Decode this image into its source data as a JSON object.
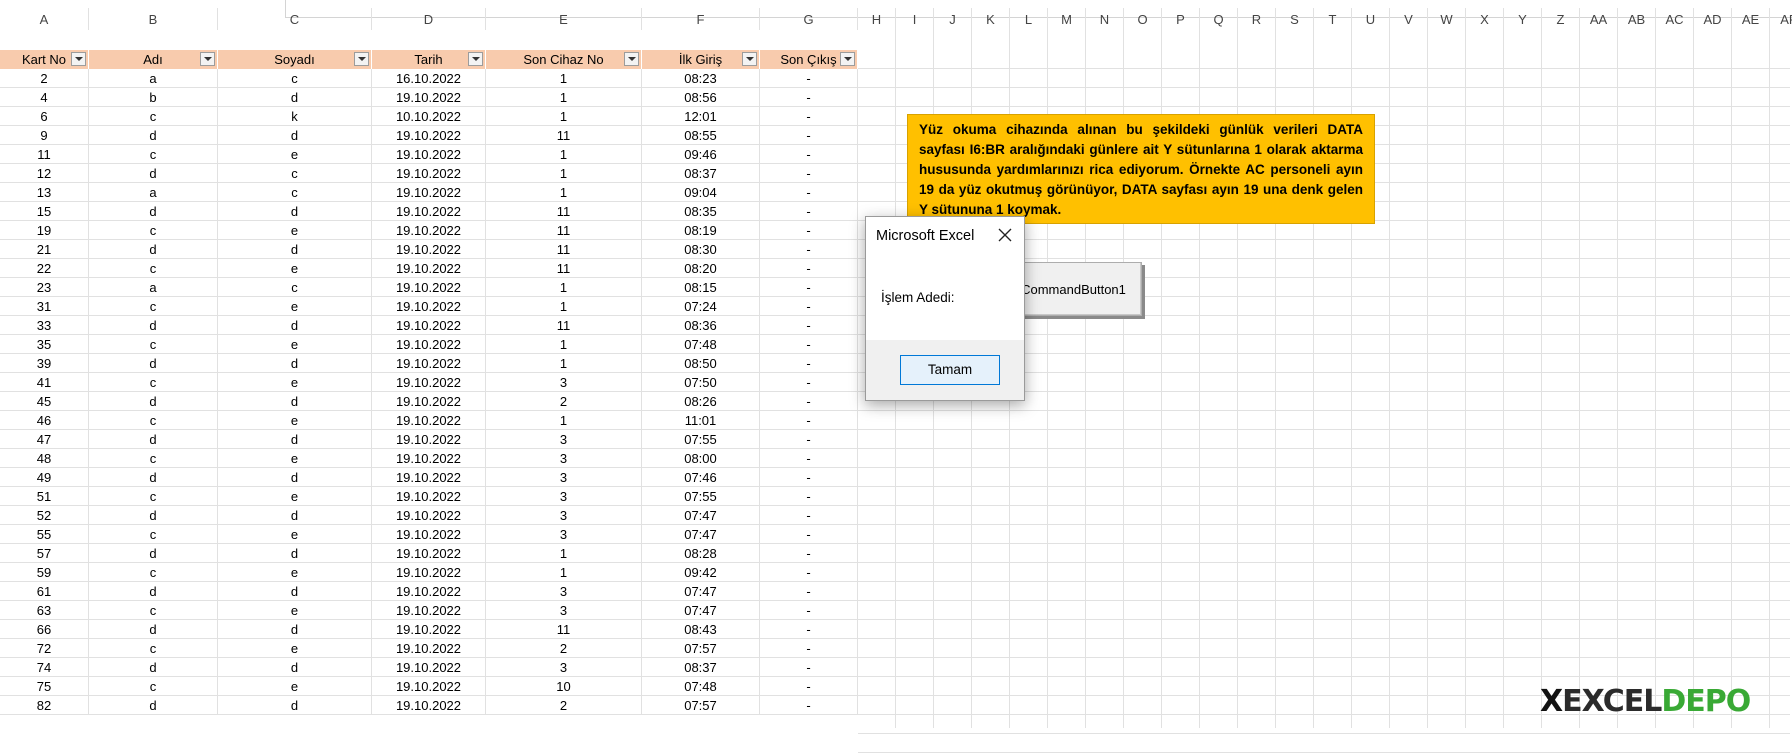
{
  "columns": [
    "A",
    "B",
    "C",
    "D",
    "E",
    "F",
    "G",
    "H",
    "I",
    "J",
    "K",
    "L",
    "M",
    "N",
    "O",
    "P",
    "Q",
    "R",
    "S",
    "T",
    "U",
    "V",
    "W",
    "X",
    "Y",
    "Z",
    "AA",
    "AB",
    "AC",
    "AD",
    "AE",
    "AF"
  ],
  "headers": [
    "Kart No",
    "Adı",
    "Soyadı",
    "Tarih",
    "Son Cihaz No",
    "İlk Giriş",
    "Son Çıkış"
  ],
  "rows": [
    [
      "2",
      "a",
      "c",
      "16.10.2022",
      "1",
      "08:23",
      "-"
    ],
    [
      "4",
      "b",
      "d",
      "19.10.2022",
      "1",
      "08:56",
      "-"
    ],
    [
      "6",
      "c",
      "k",
      "10.10.2022",
      "1",
      "12:01",
      "-"
    ],
    [
      "9",
      "d",
      "d",
      "19.10.2022",
      "11",
      "08:55",
      "-"
    ],
    [
      "11",
      "c",
      "e",
      "19.10.2022",
      "1",
      "09:46",
      "-"
    ],
    [
      "12",
      "d",
      "c",
      "19.10.2022",
      "1",
      "08:37",
      "-"
    ],
    [
      "13",
      "a",
      "c",
      "19.10.2022",
      "1",
      "09:04",
      "-"
    ],
    [
      "15",
      "d",
      "d",
      "19.10.2022",
      "11",
      "08:35",
      "-"
    ],
    [
      "19",
      "c",
      "e",
      "19.10.2022",
      "11",
      "08:19",
      "-"
    ],
    [
      "21",
      "d",
      "d",
      "19.10.2022",
      "11",
      "08:30",
      "-"
    ],
    [
      "22",
      "c",
      "e",
      "19.10.2022",
      "11",
      "08:20",
      "-"
    ],
    [
      "23",
      "a",
      "c",
      "19.10.2022",
      "1",
      "08:15",
      "-"
    ],
    [
      "31",
      "c",
      "e",
      "19.10.2022",
      "1",
      "07:24",
      "-"
    ],
    [
      "33",
      "d",
      "d",
      "19.10.2022",
      "11",
      "08:36",
      "-"
    ],
    [
      "35",
      "c",
      "e",
      "19.10.2022",
      "1",
      "07:48",
      "-"
    ],
    [
      "39",
      "d",
      "d",
      "19.10.2022",
      "1",
      "08:50",
      "-"
    ],
    [
      "41",
      "c",
      "e",
      "19.10.2022",
      "3",
      "07:50",
      "-"
    ],
    [
      "45",
      "d",
      "d",
      "19.10.2022",
      "2",
      "08:26",
      "-"
    ],
    [
      "46",
      "c",
      "e",
      "19.10.2022",
      "1",
      "11:01",
      "-"
    ],
    [
      "47",
      "d",
      "d",
      "19.10.2022",
      "3",
      "07:55",
      "-"
    ],
    [
      "48",
      "c",
      "e",
      "19.10.2022",
      "3",
      "08:00",
      "-"
    ],
    [
      "49",
      "d",
      "d",
      "19.10.2022",
      "3",
      "07:46",
      "-"
    ],
    [
      "51",
      "c",
      "e",
      "19.10.2022",
      "3",
      "07:55",
      "-"
    ],
    [
      "52",
      "d",
      "d",
      "19.10.2022",
      "3",
      "07:47",
      "-"
    ],
    [
      "55",
      "c",
      "e",
      "19.10.2022",
      "3",
      "07:47",
      "-"
    ],
    [
      "57",
      "d",
      "d",
      "19.10.2022",
      "1",
      "08:28",
      "-"
    ],
    [
      "59",
      "c",
      "e",
      "19.10.2022",
      "1",
      "09:42",
      "-"
    ],
    [
      "61",
      "d",
      "d",
      "19.10.2022",
      "3",
      "07:47",
      "-"
    ],
    [
      "63",
      "c",
      "e",
      "19.10.2022",
      "3",
      "07:47",
      "-"
    ],
    [
      "66",
      "d",
      "d",
      "19.10.2022",
      "11",
      "08:43",
      "-"
    ],
    [
      "72",
      "c",
      "e",
      "19.10.2022",
      "2",
      "07:57",
      "-"
    ],
    [
      "74",
      "d",
      "d",
      "19.10.2022",
      "3",
      "08:37",
      "-"
    ],
    [
      "75",
      "c",
      "e",
      "19.10.2022",
      "10",
      "07:48",
      "-"
    ],
    [
      "82",
      "d",
      "d",
      "19.10.2022",
      "2",
      "07:57",
      "-"
    ]
  ],
  "note": "Yüz okuma cihazında alınan bu şekildeki günlük verileri DATA sayfası I6:BR aralığındaki günlere ait Y sütunlarına 1 olarak aktarma hususunda yardımlarınızı rica ediyorum. Örnekte AC personeli ayın 19 da yüz okutmuş görünüyor, DATA sayfası ayın 19 una denk gelen Y sütununa 1 koymak.",
  "command_button": "CommandButton1",
  "dialog": {
    "title": "Microsoft Excel",
    "message": "İşlem Adedi:",
    "ok_label": "Tamam"
  },
  "logo": {
    "part1": "X",
    "part2": "EXCEL",
    "part3": "DEPO"
  },
  "colors": {
    "header_fill": "#f8cbad",
    "note_fill": "#ffc000",
    "ok_border": "#0078d7"
  }
}
